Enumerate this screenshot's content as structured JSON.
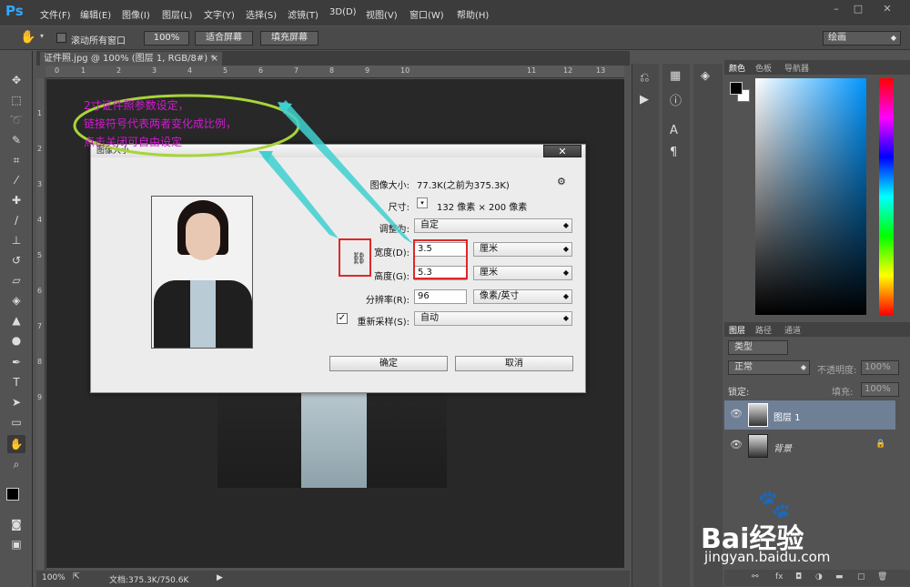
{
  "app": {
    "logo": "Ps"
  },
  "menu": [
    "文件(F)",
    "编辑(E)",
    "图像(I)",
    "图层(L)",
    "文字(Y)",
    "选择(S)",
    "滤镜(T)",
    "3D(D)",
    "视图(V)",
    "窗口(W)",
    "帮助(H)"
  ],
  "options": {
    "scroll_all_label": "滚动所有窗口",
    "zoom_label": "100%",
    "fit_label": "适合屏幕",
    "fill_label": "填充屏幕",
    "workspace": "绘画"
  },
  "document": {
    "tab_title": "证件照.jpg @ 100% (图层 1, RGB/8#) *",
    "zoom": "100%",
    "doc_info": "文档:375.3K/750.6K"
  },
  "ruler_h": [
    "0",
    "1",
    "2",
    "3",
    "4",
    "5",
    "6",
    "7",
    "8",
    "9",
    "10",
    "11",
    "12",
    "13"
  ],
  "ruler_v": [
    "1",
    "2",
    "3",
    "4",
    "5",
    "6",
    "7",
    "8",
    "9"
  ],
  "annotation": {
    "line1": "2寸证件照参数设定，",
    "line2": "链接符号代表两者变化成比例，",
    "line3": "点击关闭可自由设定"
  },
  "dialog": {
    "title": "图像大小",
    "image_size_label": "图像大小:",
    "image_size_value": "77.3K(之前为375.3K)",
    "dimension_label": "尺寸:",
    "dimension_value": "132 像素 × 200 像素",
    "fit_to_label": "调整为:",
    "fit_to_value": "自定",
    "width_label": "宽度(D):",
    "width_value": "3.5",
    "width_unit": "厘米",
    "height_label": "高度(G):",
    "height_value": "5.3",
    "height_unit": "厘米",
    "resolution_label": "分辨率(R):",
    "resolution_value": "96",
    "resolution_unit": "像素/英寸",
    "resample_label": "重新采样(S):",
    "resample_value": "自动",
    "ok_label": "确定",
    "cancel_label": "取消"
  },
  "color_panel": {
    "tabs": [
      "颜色",
      "色板",
      "导航器"
    ]
  },
  "layers_panel": {
    "tabs": [
      "图层",
      "路径",
      "通道"
    ],
    "filter_kind": "类型",
    "blend_mode": "正常",
    "opacity_label": "不透明度:",
    "opacity_value": "100%",
    "lock_label": "锁定:",
    "fill_label": "填充:",
    "fill_value": "100%",
    "layers": [
      {
        "name": "图层 1"
      },
      {
        "name": "背景"
      }
    ]
  },
  "watermark": {
    "text": "Bai经验",
    "url": "jingyan.baidu.com"
  },
  "colors": {
    "accent_ps": "#31a8ff",
    "annotation": "#d31ad3",
    "ellipse": "#a8d43a",
    "arrow": "#40d0d0",
    "highlight": "#e0262a"
  }
}
